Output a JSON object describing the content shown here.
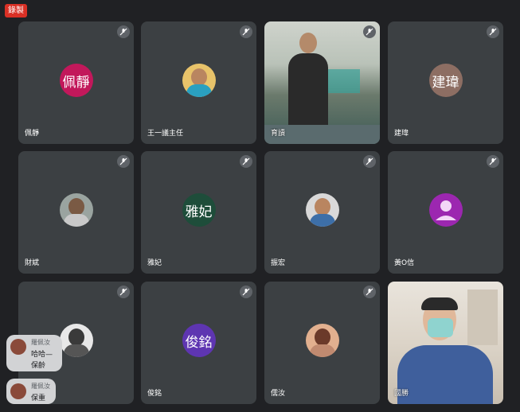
{
  "recording_badge": "錄製",
  "participants": [
    {
      "name": "佩靜",
      "avatar_text": "佩靜",
      "avatar_color": "#c2185b",
      "muted": true
    },
    {
      "name": "王一議主任",
      "avatar_type": "photo",
      "muted": true
    },
    {
      "name": "育讀",
      "video": true,
      "muted": true
    },
    {
      "name": "建瑋",
      "avatar_text": "建瑋",
      "avatar_color": "#8d6e63",
      "muted": true
    },
    {
      "name": "財斌",
      "avatar_type": "photo",
      "muted": true
    },
    {
      "name": "雅妃",
      "avatar_text": "雅妃",
      "avatar_color": "#1e4d3a",
      "muted": true
    },
    {
      "name": "振宏",
      "avatar_type": "photo",
      "muted": true
    },
    {
      "name": "黃O信",
      "avatar_type": "default",
      "avatar_color": "#9c27b0",
      "muted": true
    },
    {
      "name": "",
      "avatar_type": "photo",
      "muted": true
    },
    {
      "name": "俊銘",
      "avatar_text": "俊銘",
      "avatar_color": "#5e35b1",
      "muted": true
    },
    {
      "name": "儒汝",
      "avatar_type": "photo",
      "muted": true
    },
    {
      "name": "國勝",
      "video": true,
      "muted": false
    }
  ],
  "chat_toasts": [
    {
      "sender": "羅佩汝",
      "lines": [
        "哈哈—",
        "保齡"
      ]
    },
    {
      "sender": "羅佩汝",
      "lines": [
        "保重"
      ]
    }
  ]
}
